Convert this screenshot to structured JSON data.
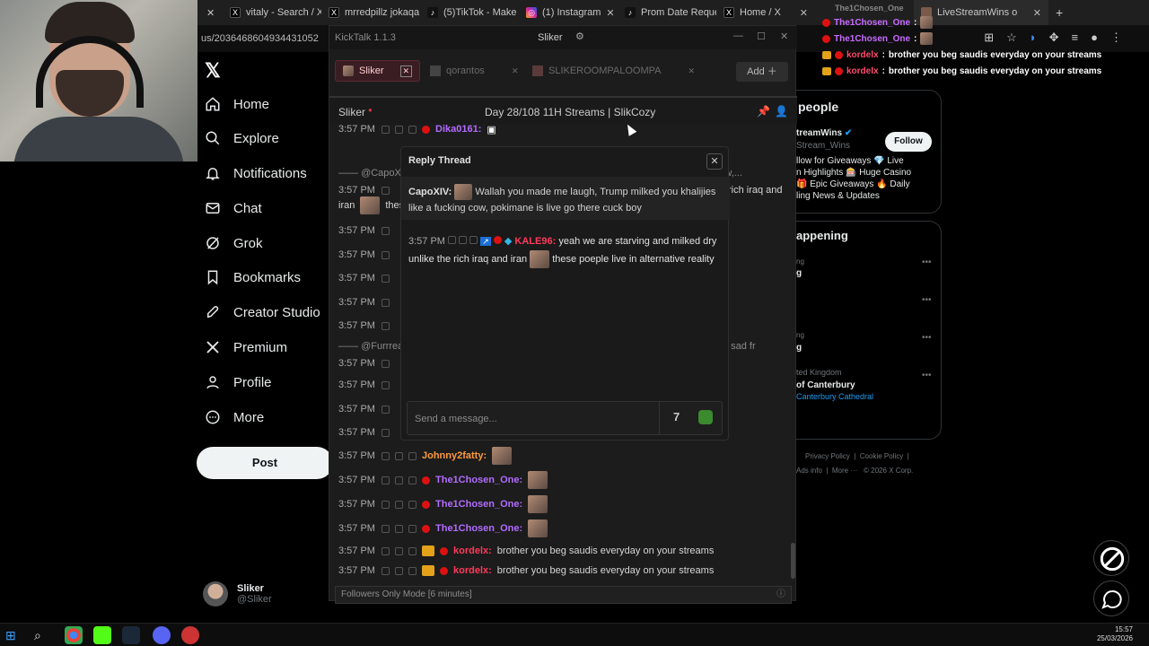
{
  "browser": {
    "tabs": [
      {
        "label": "vitaly - Search / X",
        "icon": "x-icon"
      },
      {
        "label": "mrredpillz jokaqa",
        "icon": "x-icon"
      },
      {
        "label": "(5)TikTok - Make",
        "icon": "tiktok-icon"
      },
      {
        "label": "(1) Instagram",
        "icon": "instagram-icon"
      },
      {
        "label": "Prom Date Reque",
        "icon": "tiktok-icon"
      },
      {
        "label": "Home / X",
        "icon": "x-icon"
      },
      {
        "label": "LiveStreamWins o",
        "icon": "avatar-icon"
      }
    ],
    "url": "us/2036468604934431052"
  },
  "x_nav": {
    "items": [
      {
        "label": "Home",
        "icon": "home-icon"
      },
      {
        "label": "Explore",
        "icon": "search-icon"
      },
      {
        "label": "Notifications",
        "icon": "bell-icon"
      },
      {
        "label": "Chat",
        "icon": "mail-icon"
      },
      {
        "label": "Grok",
        "icon": "grok-icon"
      },
      {
        "label": "Bookmarks",
        "icon": "bookmark-icon"
      },
      {
        "label": "Creator Studio",
        "icon": "rocket-icon"
      },
      {
        "label": "Premium",
        "icon": "x-premium-icon"
      },
      {
        "label": "Profile",
        "icon": "person-icon"
      },
      {
        "label": "More",
        "icon": "more-circle-icon"
      }
    ],
    "post_label": "Post",
    "account_name": "Sliker",
    "account_handle": "@Sliker"
  },
  "right_panel": {
    "who_to_follow_title": "people",
    "account_name": "treamWins",
    "account_handle": "Stream_Wins",
    "follow_label": "Follow",
    "bio_lines": [
      "llow for Giveaways 💎 Live",
      "n Highlights 🎰 Huge Casino",
      "🎁 Epic Giveaways 🔥 Daily",
      "ling News & Updates"
    ],
    "happening_title": "appening",
    "trend_1_a": "ng",
    "trend_1_b": "g",
    "trend_2_a": "ng",
    "trend_2_b": "g",
    "trend_3_meta": "ted Kingdom",
    "trend_3_title": "of Canterbury",
    "trend_3_link": "Canterbury Cathedral",
    "footer_1": "Privacy Policy",
    "footer_2": "Cookie Policy",
    "footer_3": "Ads info",
    "footer_4": "More ···",
    "footer_5": "© 2026 X Corp."
  },
  "chat_overlay": {
    "top_user": "The1Chosen_One",
    "lines": [
      {
        "user": "The1Chosen_One",
        "text": ""
      },
      {
        "user": "The1Chosen_One",
        "text": ""
      },
      {
        "user": "kordelx",
        "text": "brother you beg saudis everyday on your streams"
      },
      {
        "user": "kordelx",
        "text": "brother you beg saudis everyday on your streams"
      }
    ]
  },
  "kicktalk": {
    "app_title": "KickTalk 1.1.3",
    "window_channel": "Sliker",
    "tabs": [
      "Sliker",
      "qorantos",
      "SLIKEROOMPALOOMPA"
    ],
    "add_label": "Add",
    "channel_name": "Sliker",
    "stream_title": "Day 28/108 11H Streams | SlikCozy",
    "messages": [
      {
        "time": "3:57 PM",
        "user": "Dika0161:",
        "text": ""
      },
      {
        "time": "3:57 PM",
        "user": "",
        "text": ""
      },
      {
        "time": "3:57 PM",
        "user": "",
        "text": "rich iraq and"
      },
      {
        "time": "",
        "user": "",
        "text": "iran"
      },
      {
        "time": "3:57 PM",
        "user": "",
        "text": ""
      },
      {
        "time": "3:57 PM",
        "user": "",
        "text": ""
      },
      {
        "time": "3:57 PM",
        "user": "",
        "text": ""
      },
      {
        "time": "3:57 PM",
        "user": "",
        "text": ""
      },
      {
        "time": "3:57 PM",
        "user": "",
        "text": ""
      },
      {
        "time": "3:57 PM",
        "user": "",
        "text": ""
      },
      {
        "time": "3:57 PM",
        "user": "",
        "text": ""
      },
      {
        "time": "3:57 PM",
        "user": "",
        "text": ""
      },
      {
        "time": "3:57 PM",
        "user": "",
        "text": ""
      },
      {
        "time": "3:57 PM",
        "user": "Johnny2fatty:",
        "text": ""
      },
      {
        "time": "3:57 PM",
        "user": "The1Chosen_One:",
        "text": ""
      },
      {
        "time": "3:57 PM",
        "user": "The1Chosen_One:",
        "text": ""
      },
      {
        "time": "3:57 PM",
        "user": "The1Chosen_One:",
        "text": ""
      },
      {
        "time": "3:57 PM",
        "user": "kordelx:",
        "text": "brother you beg saudis everyday on your streams"
      },
      {
        "time": "3:57 PM",
        "user": "kordelx:",
        "text": "brother you beg saudis everyday on your streams"
      }
    ],
    "reply_line_1": "@CapoXI",
    "reply_line_1_tail": "cking cow,...",
    "reply_line_2": "@Furrrea",
    "reply_line_2_tail": "fall sad fr",
    "followers_mode": "Followers Only Mode [6 minutes]",
    "bottom_placeholder": "Send a message..."
  },
  "reply_thread": {
    "title": "Reply Thread",
    "parent_user": "CapoXIV:",
    "parent_text": "Wallah you made me laugh, Trump milked you khalijies like a fucking cow, pokimane is live go there cuck boy",
    "reply_time": "3:57 PM",
    "reply_user": "KALE96:",
    "reply_text_1": "yeah we are starving and milked dry unlike the rich iraq and iran",
    "reply_text_2": "these poeple live in alternative reality",
    "input_placeholder": "Send a message..."
  },
  "taskbar": {
    "time": "15:57",
    "date": "25/03/2026"
  }
}
